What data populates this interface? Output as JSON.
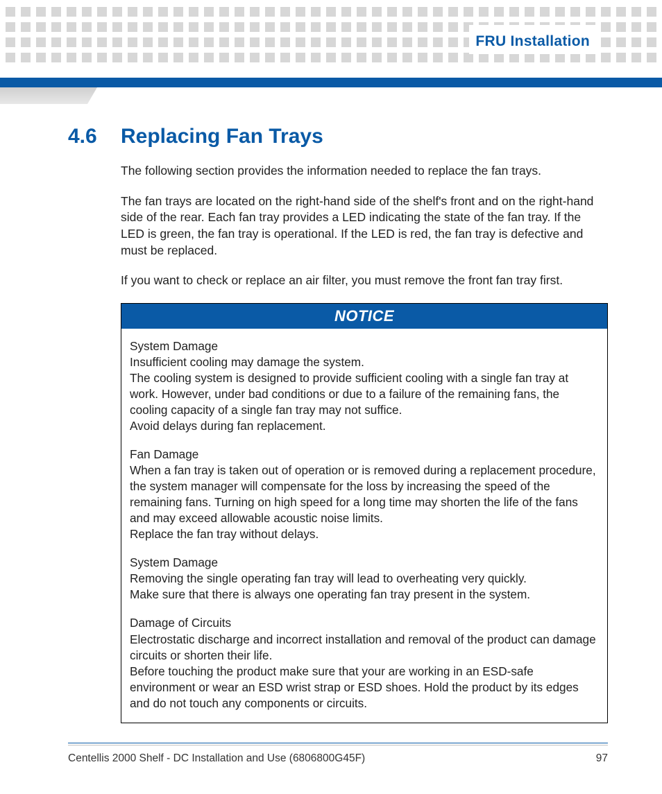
{
  "header": {
    "chapter": "FRU Installation"
  },
  "section": {
    "number": "4.6",
    "title": "Replacing Fan Trays"
  },
  "paragraphs": {
    "p1": "The following section provides the information needed to replace the fan trays.",
    "p2": "The fan trays are located on the right-hand side of the shelf's front and on the right-hand side of the rear. Each fan tray provides a LED indicating the state of the fan tray. If the LED is green, the fan tray is operational. If the LED is red, the fan tray is defective and must be replaced.",
    "p3": "If you want to check or replace an air filter, you must remove the front fan tray first."
  },
  "notice": {
    "label": "NOTICE",
    "groups": [
      {
        "title": "System Damage",
        "lines": [
          "Insufficient cooling may damage the system.",
          "The cooling system is designed to provide sufficient cooling with a single fan tray at work. However, under bad conditions or due to a failure of the remaining fans, the cooling capacity of a single fan tray may not suffice.",
          "Avoid delays during fan replacement."
        ]
      },
      {
        "title": "Fan Damage",
        "lines": [
          "When a fan tray is taken out of operation or is removed during a replacement procedure, the system manager will compensate for the loss by increasing the speed of the remaining fans. Turning on high speed for a long time may shorten the life of the fans and may exceed allowable acoustic noise limits.",
          "Replace the fan tray without delays."
        ]
      },
      {
        "title": "System Damage",
        "lines": [
          "Removing the single operating fan tray will lead to overheating very quickly.",
          "Make sure that there is always one operating fan tray present in the system."
        ]
      },
      {
        "title": "Damage of Circuits",
        "lines": [
          "Electrostatic discharge and incorrect installation and removal of the product can damage circuits or shorten their life.",
          "Before touching the product make sure that your are working in an ESD-safe environment or wear an ESD wrist strap or ESD shoes. Hold the product by its edges and do not touch any components or circuits."
        ]
      }
    ]
  },
  "footer": {
    "doc": "Centellis 2000 Shelf - DC Installation and Use (6806800G45F)",
    "page": "97"
  }
}
